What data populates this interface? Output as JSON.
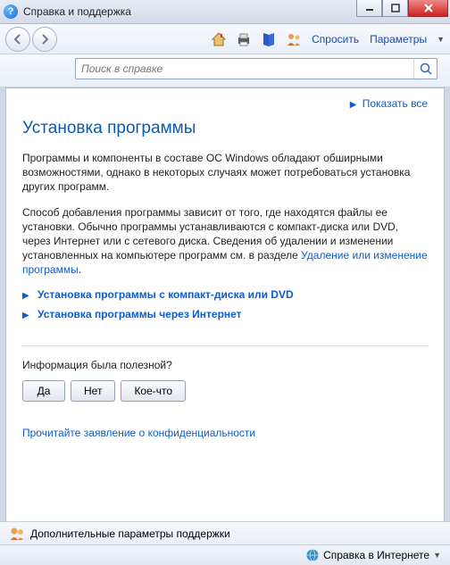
{
  "window": {
    "title": "Справка и поддержка"
  },
  "toolbar": {
    "ask": "Спросить",
    "options": "Параметры"
  },
  "search": {
    "placeholder": "Поиск в справке"
  },
  "content": {
    "show_all": "Показать все",
    "heading": "Установка программы",
    "para1": "Программы и компоненты в составе ОС Windows обладают обширными возможностями, однако в некоторых случаях может потребоваться установка других программ.",
    "para2a": "Способ добавления программы зависит от того, где находятся файлы ее установки. Обычно программы устанавливаются с компакт-диска или DVD, через Интернет или с сетевого диска. Сведения об удалении и изменении установленных на компьютере программ см. в разделе ",
    "para2_link": "Удаление или изменение программы",
    "para2b": ".",
    "expanders": [
      {
        "label": "Установка программы с компакт-диска или DVD"
      },
      {
        "label": "Установка программы через Интернет"
      }
    ],
    "feedback_q": "Информация была полезной?",
    "feedback_buttons": {
      "yes": "Да",
      "no": "Нет",
      "some": "Кое-что"
    },
    "privacy": "Прочитайте заявление о конфиденциальности"
  },
  "status": {
    "support_params": "Дополнительные параметры поддержки",
    "online_help": "Справка в Интернете"
  }
}
